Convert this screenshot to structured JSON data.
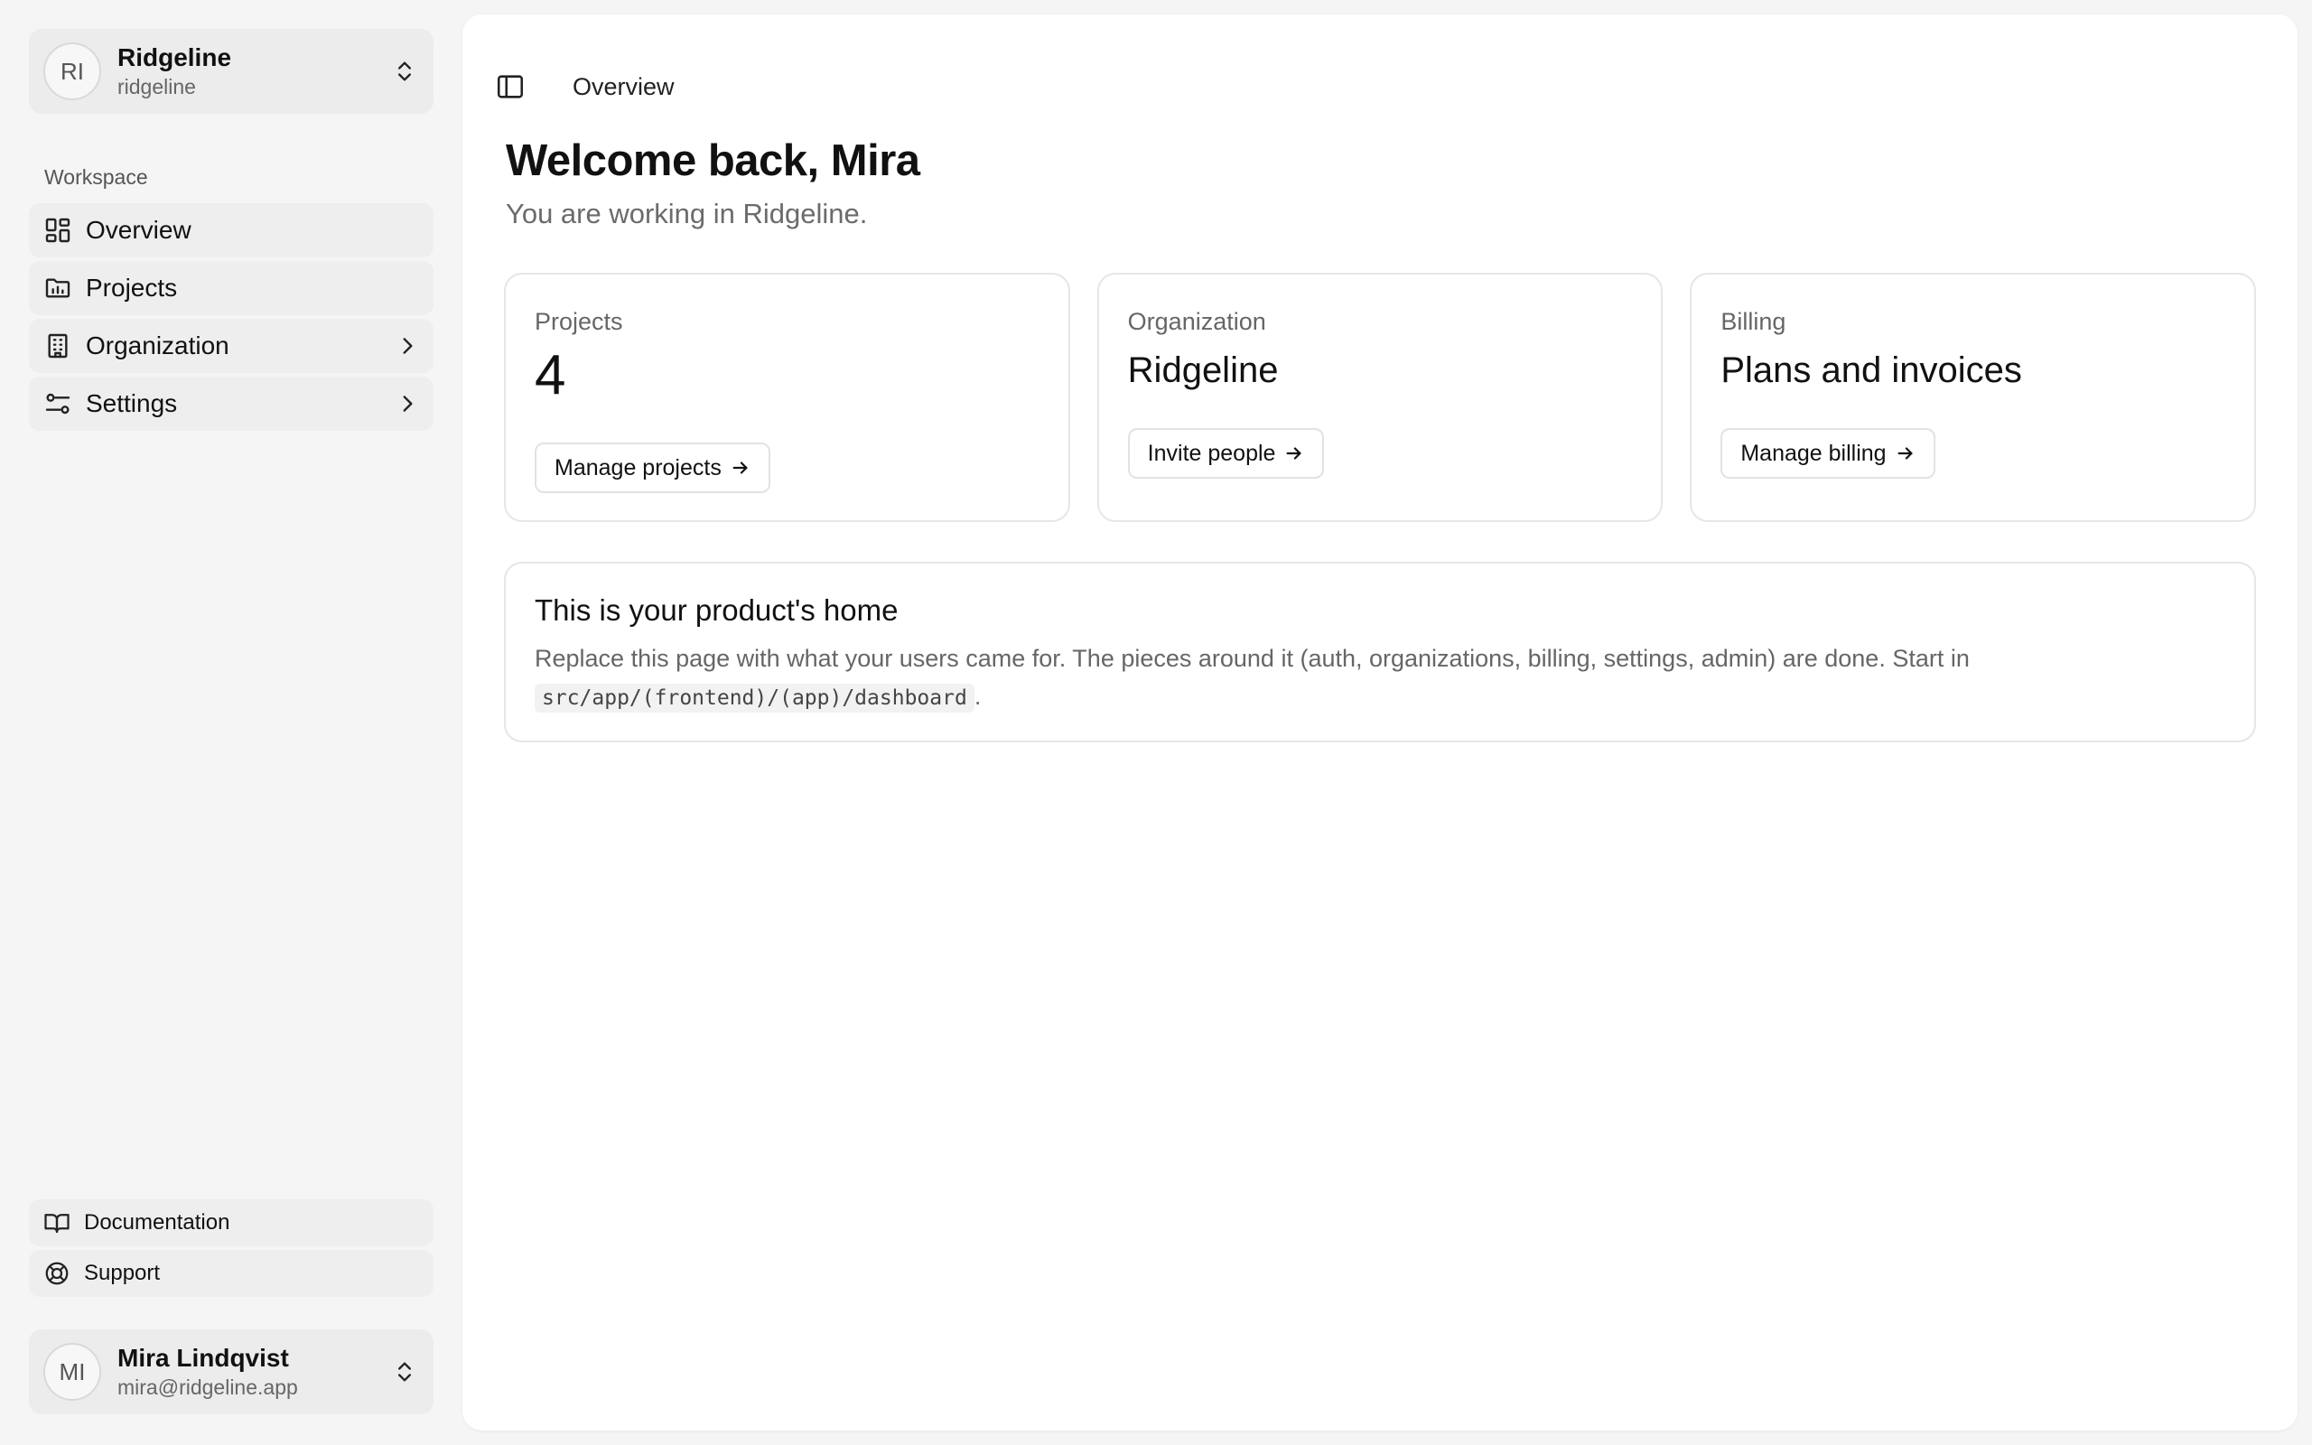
{
  "org_switcher": {
    "initials": "RI",
    "name": "Ridgeline",
    "slug": "ridgeline"
  },
  "sidebar": {
    "section_label": "Workspace",
    "items": [
      {
        "label": "Overview",
        "icon": "dashboard-icon",
        "has_chevron": false
      },
      {
        "label": "Projects",
        "icon": "folder-chart-icon",
        "has_chevron": false
      },
      {
        "label": "Organization",
        "icon": "building-icon",
        "has_chevron": true
      },
      {
        "label": "Settings",
        "icon": "sliders-icon",
        "has_chevron": true
      }
    ],
    "bottom_links": [
      {
        "label": "Documentation",
        "icon": "book-icon"
      },
      {
        "label": "Support",
        "icon": "life-buoy-icon"
      }
    ]
  },
  "user_switcher": {
    "initials": "MI",
    "name": "Mira Lindqvist",
    "email": "mira@ridgeline.app"
  },
  "topbar": {
    "breadcrumb": "Overview"
  },
  "welcome": {
    "title": "Welcome back, Mira",
    "subtitle": "You are working in Ridgeline."
  },
  "cards": [
    {
      "label": "Projects",
      "value": "4",
      "button": "Manage projects"
    },
    {
      "label": "Organization",
      "value": "Ridgeline",
      "button": "Invite people"
    },
    {
      "label": "Billing",
      "value": "Plans and invoices",
      "button": "Manage billing"
    }
  ],
  "home": {
    "title": "This is your product's home",
    "body": "Replace this page with what your users came for. The pieces around it (auth, organizations, billing, settings, admin) are done. Start in",
    "path": "src/app/(frontend)/(app)/dashboard",
    "period": "."
  }
}
